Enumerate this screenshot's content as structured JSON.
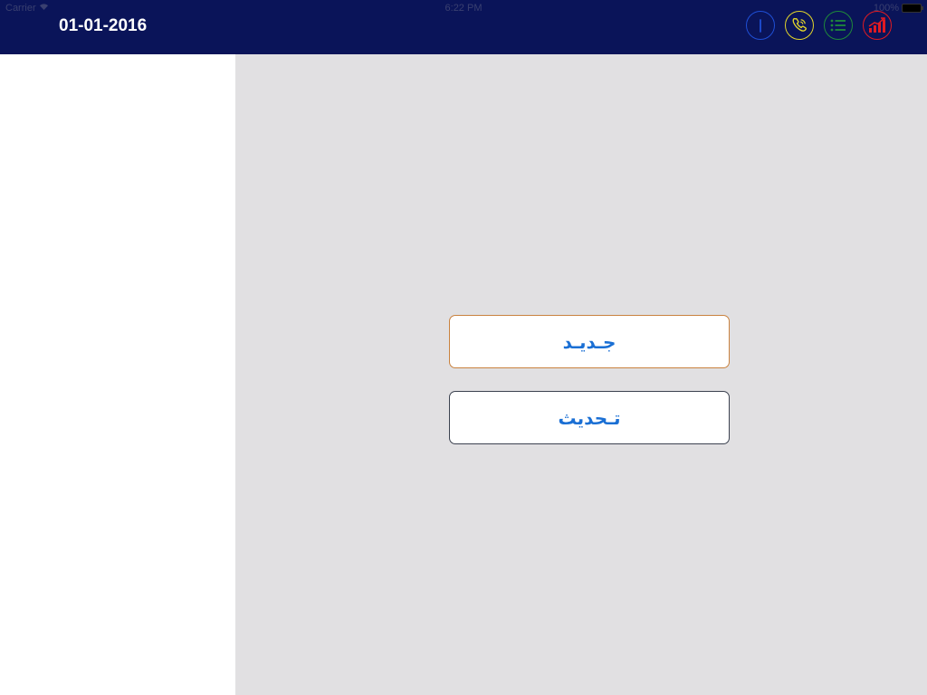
{
  "status_bar": {
    "carrier": "Carrier",
    "time": "6:22 PM",
    "battery": "100%"
  },
  "header": {
    "date": "01-01-2016",
    "icons": [
      {
        "name": "info-icon",
        "color": "#1f4fd6"
      },
      {
        "name": "phone-icon",
        "color": "#e3d62a"
      },
      {
        "name": "list-icon",
        "color": "#1f8a3a"
      },
      {
        "name": "chart-icon",
        "color": "#e11b22"
      }
    ]
  },
  "buttons": {
    "new_label": "جـديـد",
    "update_label": "تـحديث"
  },
  "colors": {
    "header_bg": "#0a1459",
    "main_bg": "#e1e0e2",
    "button_text": "#1a6fd4"
  }
}
